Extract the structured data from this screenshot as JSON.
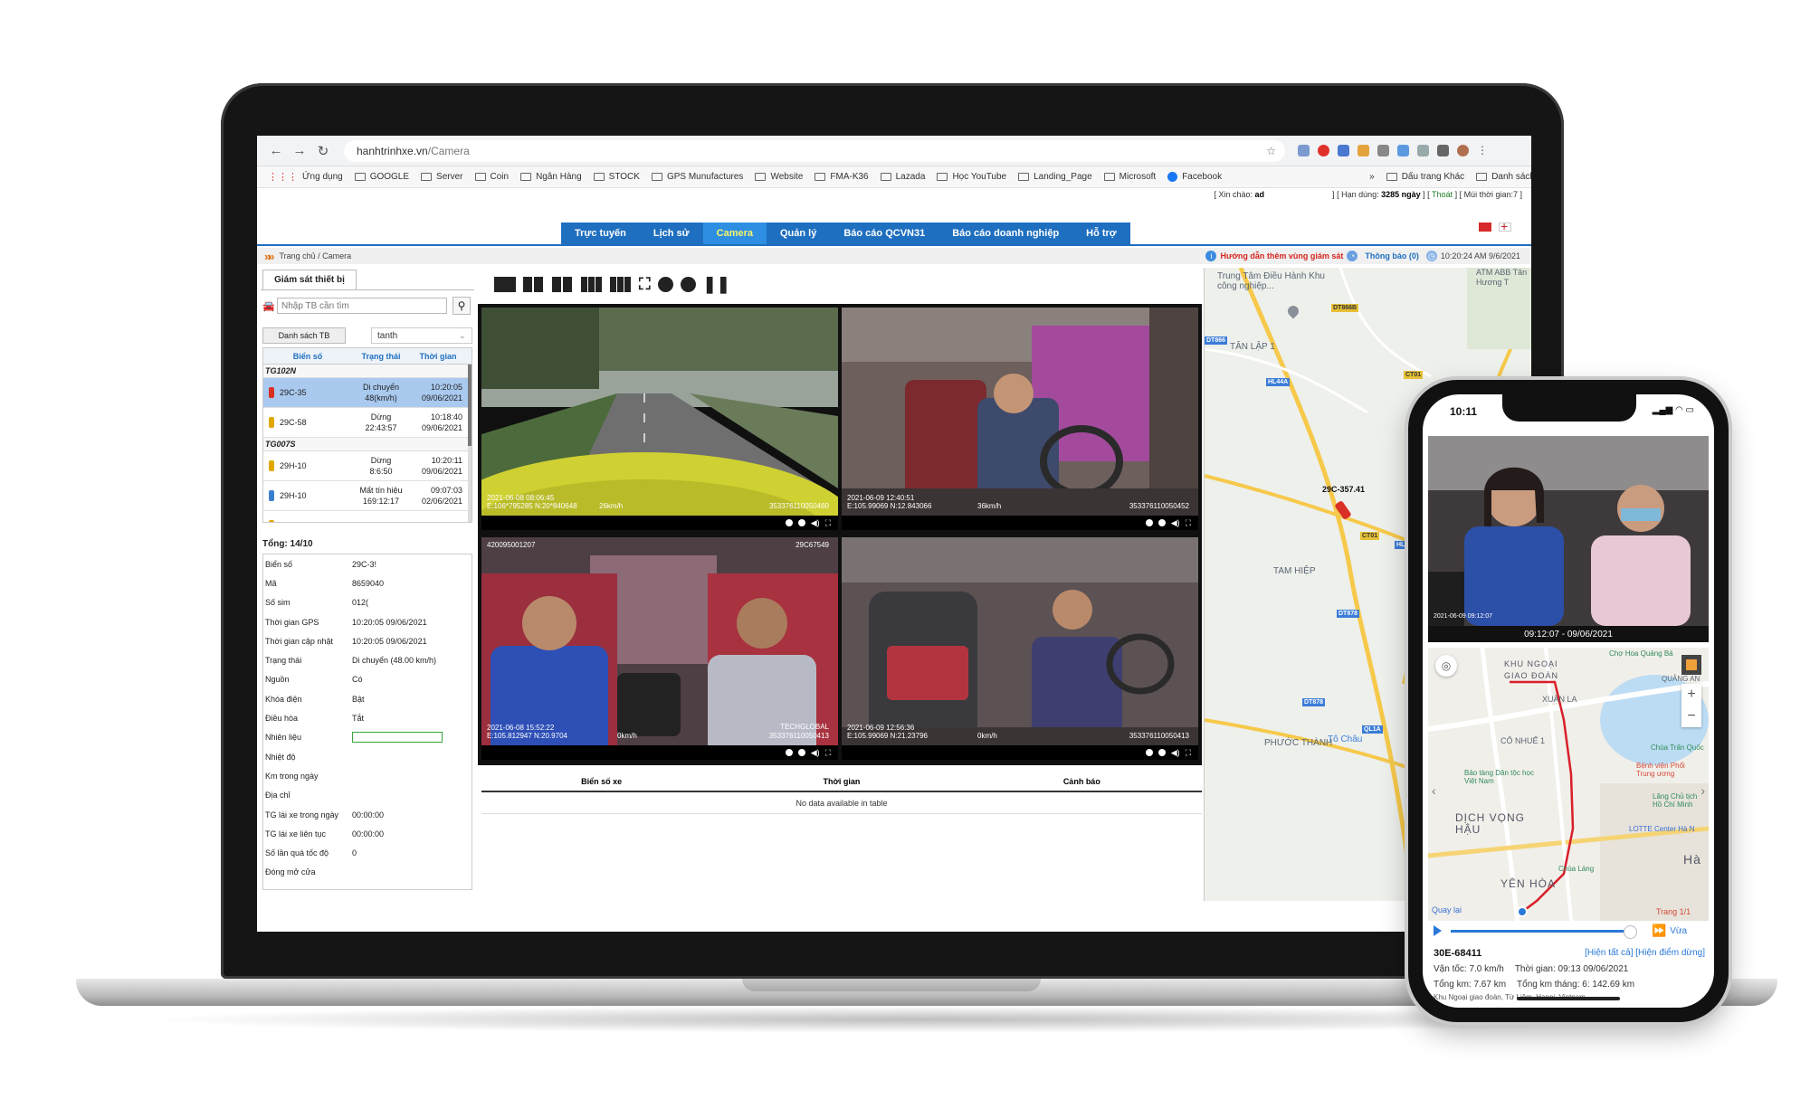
{
  "browser": {
    "url_host": "hanhtrinhxe.vn",
    "url_path": "/Camera",
    "bookmarks": [
      "Ứng dụng",
      "GOOGLE",
      "Server",
      "Coin",
      "Ngân Hàng",
      "STOCK",
      "GPS Munufactures",
      "Website",
      "FMA-K36",
      "Lazada",
      "Học YouTube",
      "Landing_Page",
      "Microsoft",
      "Facebook"
    ],
    "bookmarks_more": "»",
    "bookmarks_other": "Dấu trang Khác",
    "reading_list": "Danh sách đọc"
  },
  "header": {
    "greeting_label": "[ Xin chào:",
    "greeting_user": "ad",
    "expiry_label": "] [ Hạn dùng:",
    "expiry_value": "3285 ngày",
    "logout_open": "] [",
    "logout": "Thoát",
    "timezone": "] [ Múi thời gian:7 ]"
  },
  "menu": [
    "Trực tuyến",
    "Lịch sử",
    "Camera",
    "Quản lý",
    "Báo cáo QCVN31",
    "Báo cáo doanh nghiệp",
    "Hỗ trợ"
  ],
  "menu_active_index": 2,
  "breadcrumb": {
    "path": "Trang chủ / Camera",
    "guide": "Hướng dẫn thêm vùng giám sát",
    "notify_label": "Thông báo",
    "notify_count": "(0)",
    "datetime": "10:20:24 AM 9/6/2021"
  },
  "left_panel": {
    "tab": "Giám sát thiết bị",
    "search_placeholder": "Nhập TB cần tìm",
    "list_tab": "Danh sách TB",
    "user_filter": "tanth",
    "columns": [
      "Biển số",
      "Trạng thái",
      "Thời gian"
    ],
    "groups": [
      {
        "name": "TG102N",
        "rows": [
          {
            "plate": "29C-35",
            "status1": "Di chuyển",
            "status2": "48(km/h)",
            "time1": "10:20:05",
            "time2": "09/06/2021",
            "color": "#d93025",
            "selected": true
          },
          {
            "plate": "29C-58",
            "status1": "Dừng",
            "status2": "22:43:57",
            "time1": "10:18:40",
            "time2": "09/06/2021",
            "color": "#e0a800",
            "selected": false
          }
        ]
      },
      {
        "name": "TG007S",
        "rows": [
          {
            "plate": "29H-10",
            "status1": "Dừng",
            "status2": "8:6:50",
            "time1": "10:20:11",
            "time2": "09/06/2021",
            "color": "#e0a800",
            "selected": false
          },
          {
            "plate": "29H-10",
            "status1": "Mất tín hiệu",
            "status2": "169:12:17",
            "time1": "09:07:03",
            "time2": "02/06/2021",
            "color": "#3a7fd0",
            "selected": false
          },
          {
            "plate": "29H-14",
            "status1": "Dừng",
            "status2": "",
            "time1": "10:20:06",
            "time2": "",
            "color": "#e0a800",
            "selected": false
          }
        ]
      }
    ],
    "total": "Tổng: 14/10",
    "details": [
      {
        "k": "Biển số",
        "v": "29C-3!"
      },
      {
        "k": "Mã",
        "v": "8659040"
      },
      {
        "k": "Số sim",
        "v": "012("
      },
      {
        "k": "Thời gian GPS",
        "v": "10:20:05 09/06/2021"
      },
      {
        "k": "Thời gian cập nhật",
        "v": "10:20:05 09/06/2021"
      },
      {
        "k": "Trạng thái",
        "v": "Di chuyển (48.00 km/h)"
      },
      {
        "k": "Nguồn",
        "v": "Có"
      },
      {
        "k": "Khóa điện",
        "v": "Bật"
      },
      {
        "k": "Điều hòa",
        "v": "Tắt"
      },
      {
        "k": "Nhiên liệu",
        "v": ""
      },
      {
        "k": "Nhiệt độ",
        "v": ""
      },
      {
        "k": "Km trong ngày",
        "v": ""
      },
      {
        "k": "Địa chỉ",
        "v": ""
      },
      {
        "k": "TG lái xe trong ngày",
        "v": "00:00:00"
      },
      {
        "k": "TG lái xe liên tục",
        "v": "00:00:00"
      },
      {
        "k": "Số lần quá tốc độ",
        "v": "0"
      },
      {
        "k": "Đóng mở cửa",
        "v": ""
      }
    ]
  },
  "cameras": [
    {
      "ts1": "2021-06-08  08:06:45",
      "ts2": "E:106*795285  N:20*840648",
      "speed": "26km/h",
      "id": "353376110050460"
    },
    {
      "ts1": "2021-06-09   12:40:51",
      "ts2": "E:105.99069   N:12.843066",
      "speed": "36km/h",
      "id": "353376110050452"
    },
    {
      "ts1": "2021-06-08   15:52:22",
      "ts2": "E:105.812947  N:20.9704",
      "speed": "0km/h",
      "id": "353376110050413",
      "top_left": "420095001207",
      "top_right": "29C67549",
      "brand": "TECHGLOBAL"
    },
    {
      "ts1": "2021-06-09   12:56:36",
      "ts2": "E:105.99069   N:21.23796",
      "speed": "0km/h",
      "id": "353376110050413"
    }
  ],
  "events": {
    "columns": [
      "Biển số xe",
      "Thời gian",
      "Cảnh báo"
    ],
    "empty": "No data available in table"
  },
  "map": {
    "labels": [
      "Trung Tâm Điều Hành Khu công nghiệp...",
      "TÂN LẬP 1",
      "TAM HIỆP",
      "PHƯỚC THÀNH",
      "Tô Châu",
      "ATM ABB Tân Hương T"
    ],
    "road_tags": [
      "DT866",
      "DT866B",
      "CT01",
      "HL44A",
      "CT01",
      "HL5",
      "DT878",
      "DT878",
      "QL1A"
    ],
    "vehicle_label": "29C-357.41"
  },
  "phone": {
    "time": "10:11",
    "status_icons": "▂▄▆ ◠ ▭",
    "video_timestamp": "09:12:07 - 09/06/2021",
    "video_overlay": "2021-06-09  09:12:07",
    "map_labels": [
      "KHU NGOẠI GIAO ĐOÀN",
      "XUÂN LA",
      "CỔ NHUẾ 1",
      "DỊCH VỌNG HẬU",
      "YÊN HÒA",
      "Hà",
      "QUẢNG AN"
    ],
    "pois": [
      "Chợ Hoa Quảng Bá",
      "Bảo tàng Dân tộc học Việt Nam",
      "Bệnh viện Phổi Trung ương",
      "Lăng Chủ tịch Hồ Chí Minh",
      "LOTTE Center Hà N",
      "Chùa Trấn Quốc",
      "Chùa Láng"
    ],
    "quay_lai": "Quay lại",
    "trang": "Trang 1/1",
    "speed_label": "Vừa",
    "plate": "30E-68411",
    "link_all": "[Hiện tất cả]",
    "link_stop": "[Hiện điểm dừng]",
    "velocity": "Vận tốc: 7.0 km/h",
    "time_label": "Thời gian: 09:13 09/06/2021",
    "total_km": "Tổng km: 7.67 km",
    "month_km": "Tổng km tháng: 6: 142.69 km",
    "address": "Khu Ngoại giao đoàn, Từ Liêm, Hanoi, Vietnam"
  }
}
